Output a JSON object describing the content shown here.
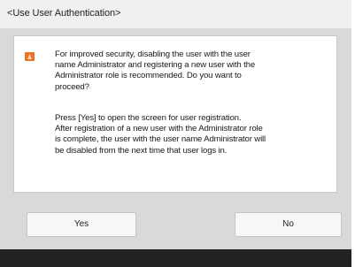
{
  "window": {
    "title": "<Use User Authentication>"
  },
  "dialog": {
    "icon": "warning-icon",
    "message_paragraph_1": "For improved security, disabling the user with the user\nname Administrator and registering a new user with the\nAdministrator role is recommended. Do you want to\nproceed?",
    "message_paragraph_2": "Press [Yes] to open the screen for user registration.\nAfter registration of a new user with the Administrator role\nis complete, the user with the user name Administrator will\nbe disabled from the next time that user logs in."
  },
  "buttons": {
    "yes_label": "Yes",
    "no_label": "No"
  },
  "colors": {
    "title_bar": "#f0f0f0",
    "background": "#d9d9d9",
    "dialog": "#ffffff",
    "icon": "#e8742a",
    "footer": "#222222"
  }
}
